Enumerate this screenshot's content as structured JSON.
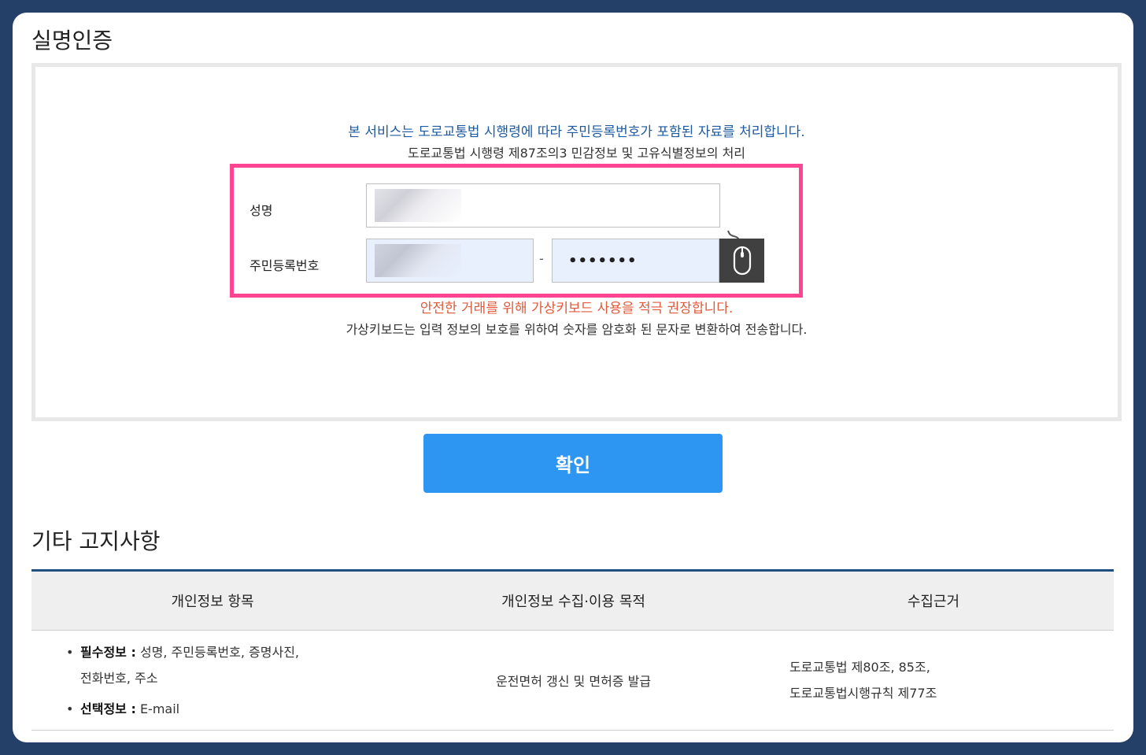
{
  "auth_section": {
    "title": "실명인증",
    "notice_line1": "본 서비스는 도로교통법 시행령에 따라 주민등록번호가 포함된 자료를 처리합니다.",
    "notice_line2": "도로교통법 시행령 제87조의3 민감정보 및 고유식별정보의 처리",
    "form": {
      "name_label": "성명",
      "name_value": "",
      "rrn_label": "주민등록번호",
      "rrn_front_value": "",
      "rrn_separator": "-",
      "rrn_back_value": "•••••••",
      "keypad_icon": "mouse-icon"
    },
    "warning": "안전한 거래를 위해 가상키보드 사용을 적극 권장합니다.",
    "keypad_notice": "가상키보드는 입력 정보의 보호를 위하여 숫자를 암호화 된 문자로 변환하여 전송합니다.",
    "confirm_label": "확인"
  },
  "notice_section": {
    "title": "기타 고지사항",
    "columns": [
      "개인정보 항목",
      "개인정보 수집·이용 목적",
      "수집근거"
    ],
    "row": {
      "required_label": "필수정보 :",
      "required_items": " 성명, 주민등록번호, 증명사진,",
      "required_items_cont": "전화번호, 주소",
      "optional_label": "선택정보 :",
      "optional_items": " E-mail",
      "purpose": "운전면허 갱신 및 면허증 발급",
      "basis_line1": "도로교통법 제80조, 85조,",
      "basis_line2": "도로교통법시행규칙 제77조"
    }
  },
  "colors": {
    "frame_bg": "#243f68",
    "accent_blue": "#2d96f2",
    "highlight_pink": "#ff4592",
    "notice_blue": "#1e5aa0",
    "warning_red": "#e0593a"
  }
}
